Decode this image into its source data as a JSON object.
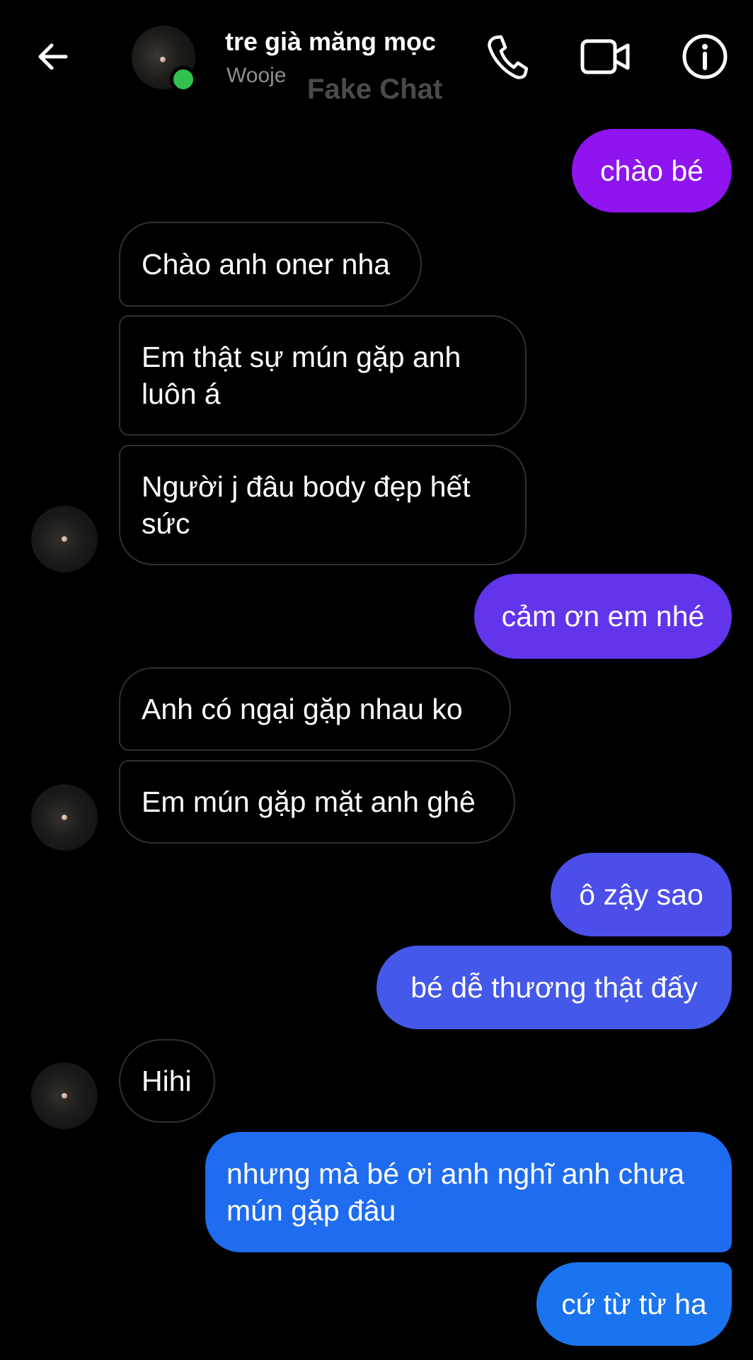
{
  "header": {
    "contact_name": "tre già măng mọc",
    "contact_status": "Wooje",
    "watermark": "Fake Chat",
    "icons": {
      "back": "arrow-left-icon",
      "call": "phone-icon",
      "video": "video-camera-icon",
      "info": "info-icon"
    },
    "online_color": "#31c24d"
  },
  "messages": [
    {
      "from": "me",
      "text": "chào bé",
      "color": "#8f14ef"
    },
    {
      "from": "them",
      "text": "Chào anh oner nha"
    },
    {
      "from": "them",
      "text": "Em thật sự mún gặp anh luôn á"
    },
    {
      "from": "them",
      "text": "Người j đâu body đẹp hết sức"
    },
    {
      "from": "me",
      "text": "cảm ơn em nhé",
      "color": "#6234ec"
    },
    {
      "from": "them",
      "text": "Anh có ngại gặp nhau ko"
    },
    {
      "from": "them",
      "text": "Em mún gặp mặt anh ghê"
    },
    {
      "from": "me",
      "text": "ô zậy sao",
      "color": "#4b4ee9"
    },
    {
      "from": "me",
      "text": "bé dễ thương thật đấy",
      "color": "#4458e9"
    },
    {
      "from": "them",
      "text": "Hihi"
    },
    {
      "from": "me",
      "text": "nhưng mà bé ơi anh nghĩ anh chưa mún gặp đâu",
      "color": "#1f6cf0"
    },
    {
      "from": "me",
      "text": "cứ từ từ ha",
      "color": "#1a74ef"
    }
  ],
  "theme": {
    "background": "#000000",
    "received_border": "#303030",
    "status_text": "#8e8e8e"
  }
}
